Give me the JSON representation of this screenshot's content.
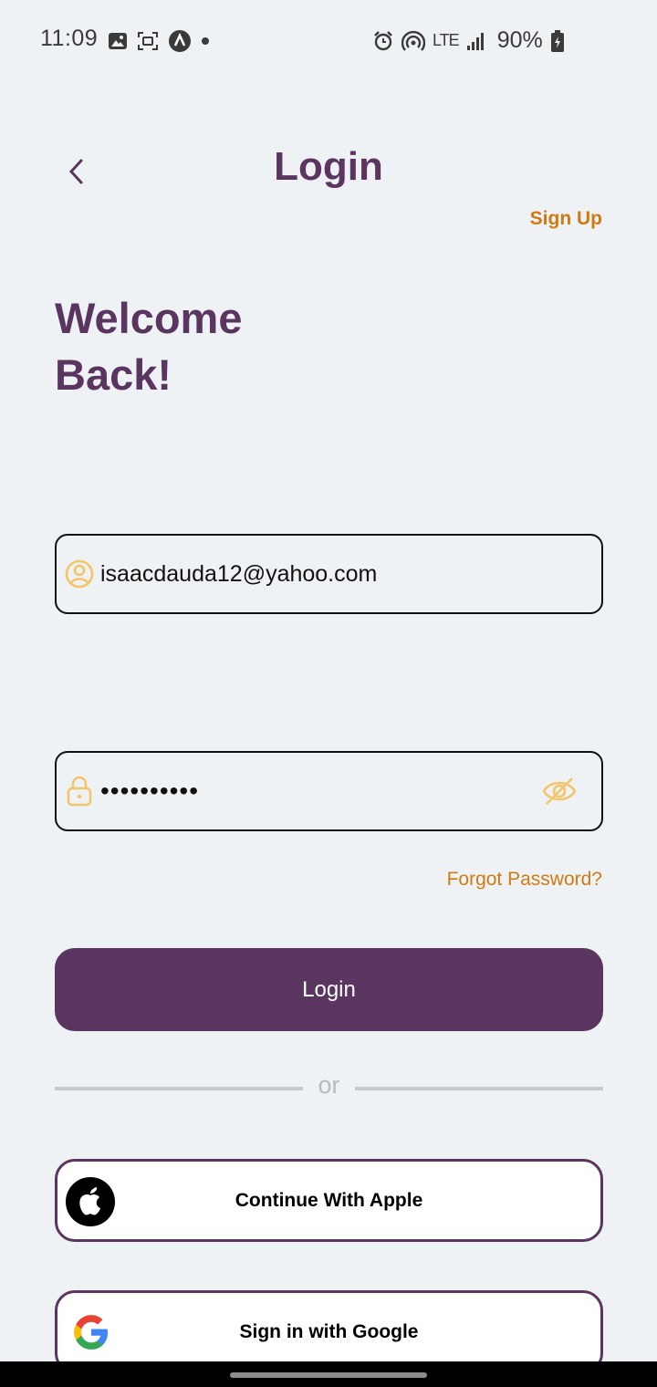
{
  "status_bar": {
    "time": "11:09",
    "network": "LTE",
    "battery": "90%"
  },
  "header": {
    "title": "Login",
    "signup_label": "Sign Up"
  },
  "welcome": {
    "line1": "Welcome",
    "line2": "Back!"
  },
  "form": {
    "email_value": "isaacdauda12@yahoo.com",
    "password_mask": "••••••••••",
    "forgot_label": "Forgot Password?",
    "login_label": "Login"
  },
  "divider": {
    "text": "or"
  },
  "social": {
    "apple_label": "Continue With Apple",
    "google_label": "Sign in with Google"
  },
  "colors": {
    "primary": "#5a3560",
    "accent": "#d07a12",
    "background": "#eef2f5",
    "icon_yellow": "#f2c56b"
  }
}
